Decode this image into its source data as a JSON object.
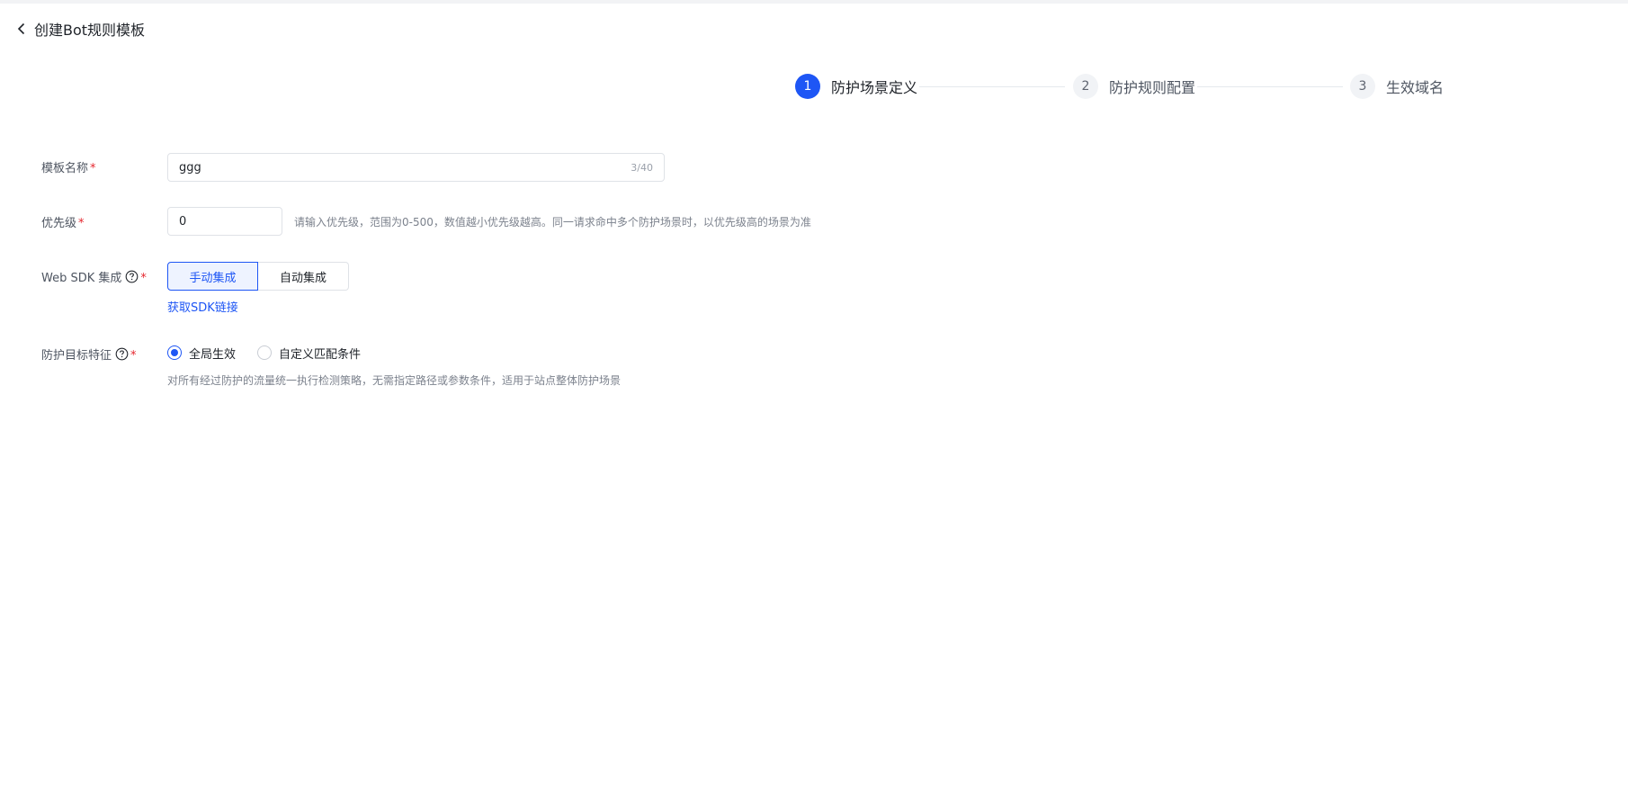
{
  "header": {
    "title": "创建Bot规则模板"
  },
  "steps": [
    {
      "number": "1",
      "label": "防护场景定义"
    },
    {
      "number": "2",
      "label": "防护规则配置"
    },
    {
      "number": "3",
      "label": "生效域名"
    }
  ],
  "form": {
    "template_name": {
      "label": "模板名称",
      "value": "ggg",
      "counter": "3/40"
    },
    "priority": {
      "label": "优先级",
      "value": "0",
      "hint": "请输入优先级，范围为0-500，数值越小优先级越高。同一请求命中多个防护场景时，以优先级高的场景为准"
    },
    "web_sdk": {
      "label": "Web SDK 集成",
      "options": [
        "手动集成",
        "自动集成"
      ],
      "selected": "手动集成",
      "link": "获取SDK链接"
    },
    "target": {
      "label": "防护目标特征",
      "options": [
        "全局生效",
        "自定义匹配条件"
      ],
      "selected": "全局生效",
      "hint": "对所有经过防护的流量统一执行检测策略，无需指定路径或参数条件，适用于站点整体防护场景"
    },
    "required_mark": "*"
  },
  "colors": {
    "primary": "#1e56f5",
    "required": "#e5262e"
  }
}
